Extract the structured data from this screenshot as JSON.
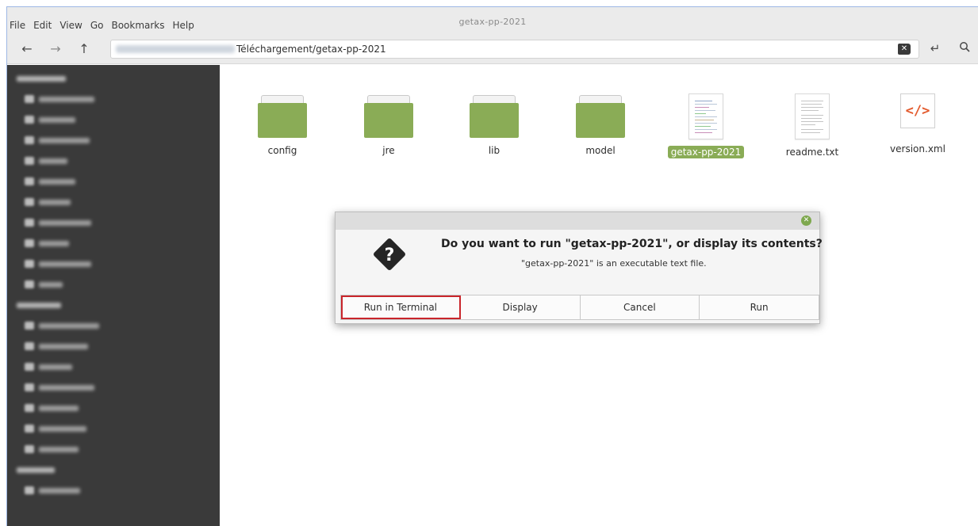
{
  "window": {
    "title": "getax-pp-2021"
  },
  "menubar": {
    "items": [
      "File",
      "Edit",
      "View",
      "Go",
      "Bookmarks",
      "Help"
    ]
  },
  "toolbar": {
    "back_icon": "arrow-left-icon",
    "forward_icon": "arrow-right-icon",
    "up_icon": "arrow-up-icon",
    "path_visible": "Téléchargement/getax-pp-2021",
    "clear_icon": "backspace-icon",
    "toggle_icon": "location-toggle-icon",
    "search_icon": "search-icon"
  },
  "files": [
    {
      "name": "config",
      "type": "folder",
      "selected": false
    },
    {
      "name": "jre",
      "type": "folder",
      "selected": false
    },
    {
      "name": "lib",
      "type": "folder",
      "selected": false
    },
    {
      "name": "model",
      "type": "folder",
      "selected": false
    },
    {
      "name": "getax-pp-2021",
      "type": "script",
      "selected": true
    },
    {
      "name": "readme.txt",
      "type": "text",
      "selected": false
    },
    {
      "name": "version.xml",
      "type": "xml",
      "selected": false
    }
  ],
  "dialog": {
    "heading": "Do you want to run \"getax-pp-2021\", or display its contents?",
    "subtext": "\"getax-pp-2021\" is an executable text file.",
    "buttons": [
      "Run in Terminal",
      "Display",
      "Cancel",
      "Run"
    ],
    "highlighted_button": "Run in Terminal",
    "highlight_color": "#c9252b",
    "icon": "question-diamond-icon",
    "close_icon": "close-icon"
  },
  "colors": {
    "accent": "#8aac56",
    "sidebar_bg": "#3a3a3a"
  }
}
